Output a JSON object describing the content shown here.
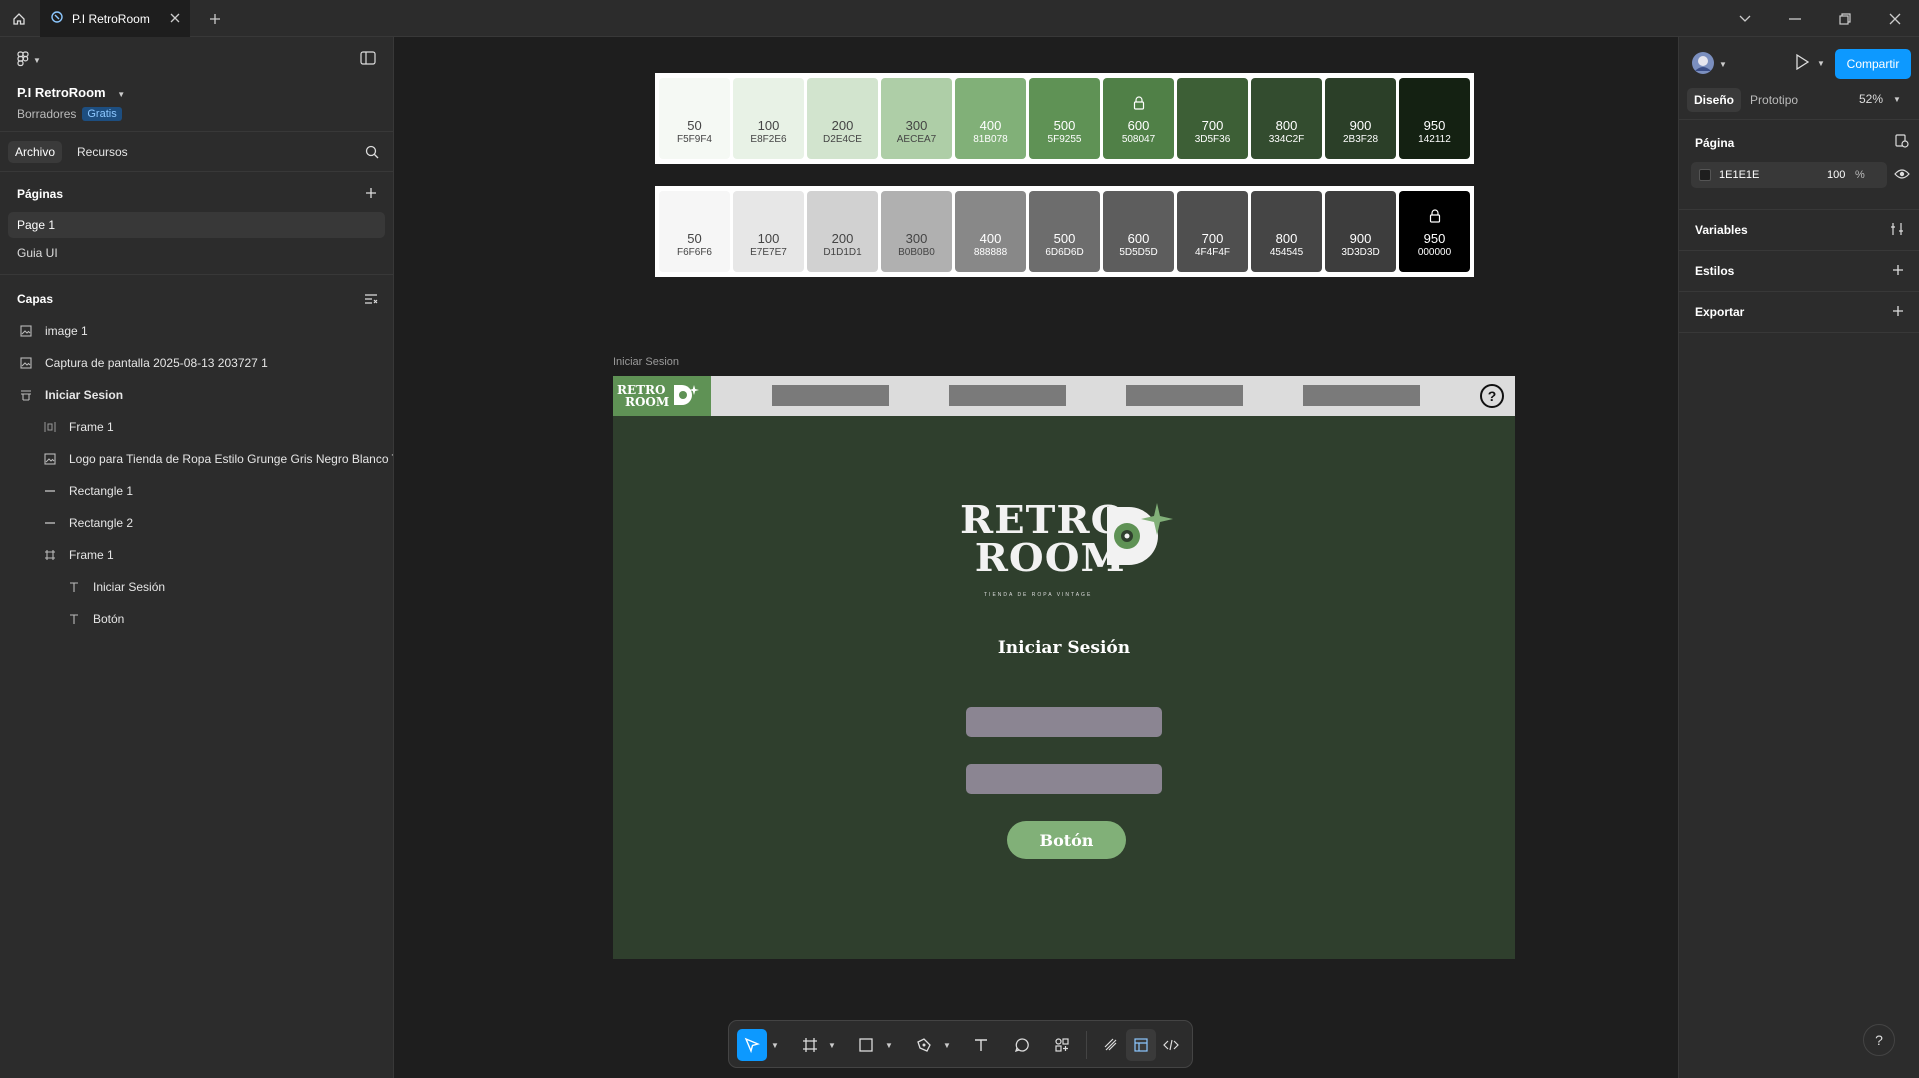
{
  "topbar": {
    "tab_title": "P.I RetroRoom"
  },
  "left_panel": {
    "file_name": "P.I RetroRoom",
    "team": "Borradores",
    "plan_badge": "Gratis",
    "tabs": [
      "Archivo",
      "Recursos"
    ],
    "pages_header": "Páginas",
    "pages": [
      "Page 1",
      "Guia UI"
    ],
    "layers_header": "Capas",
    "layers": [
      {
        "label": "image 1",
        "icon": "image-icon",
        "indent": 0
      },
      {
        "label": "Captura de pantalla 2025-08-13 203727 1",
        "icon": "image-icon",
        "indent": 0
      },
      {
        "label": "Iniciar Sesion",
        "icon": "frame-layout-icon",
        "indent": 0
      },
      {
        "label": "Frame 1",
        "icon": "autolayout-icon",
        "indent": 1
      },
      {
        "label": "Logo para Tienda de Ropa Estilo Grunge Gris Negro Blanco Tur",
        "icon": "image-icon",
        "indent": 1
      },
      {
        "label": "Rectangle 1",
        "icon": "line-icon",
        "indent": 1
      },
      {
        "label": "Rectangle 2",
        "icon": "line-icon",
        "indent": 1
      },
      {
        "label": "Frame 1",
        "icon": "frame-icon",
        "indent": 1
      },
      {
        "label": "Iniciar Sesión",
        "icon": "text-icon",
        "indent": 2
      },
      {
        "label": "Botón",
        "icon": "text-icon",
        "indent": 2
      }
    ]
  },
  "right_panel": {
    "share_label": "Compartir",
    "tabs": [
      "Diseño",
      "Prototipo"
    ],
    "zoom": "52%",
    "page_header": "Página",
    "page_color": "1E1E1E",
    "page_opacity": "100",
    "percent_sign": "%",
    "variables": "Variables",
    "styles": "Estilos",
    "export": "Exportar"
  },
  "canvas": {
    "green_palette": [
      {
        "name": "50",
        "hex": "F5F9F4",
        "color": "#F5F9F4",
        "text": "#444444",
        "locked": false
      },
      {
        "name": "100",
        "hex": "E8F2E6",
        "color": "#E8F2E6",
        "text": "#444444",
        "locked": false
      },
      {
        "name": "200",
        "hex": "D2E4CE",
        "color": "#D2E4CE",
        "text": "#444444",
        "locked": false
      },
      {
        "name": "300",
        "hex": "AECEA7",
        "color": "#AECEA7",
        "text": "#444444",
        "locked": false
      },
      {
        "name": "400",
        "hex": "81B078",
        "color": "#81B078",
        "text": "#ffffff",
        "locked": false
      },
      {
        "name": "500",
        "hex": "5F9255",
        "color": "#5F9255",
        "text": "#ffffff",
        "locked": false
      },
      {
        "name": "600",
        "hex": "508047",
        "color": "#508047",
        "text": "#ffffff",
        "locked": true
      },
      {
        "name": "700",
        "hex": "3D5F36",
        "color": "#3D5F36",
        "text": "#ffffff",
        "locked": false
      },
      {
        "name": "800",
        "hex": "334C2F",
        "color": "#334C2F",
        "text": "#ffffff",
        "locked": false
      },
      {
        "name": "900",
        "hex": "2B3F28",
        "color": "#2B3F28",
        "text": "#ffffff",
        "locked": false
      },
      {
        "name": "950",
        "hex": "142112",
        "color": "#142112",
        "text": "#ffffff",
        "locked": false
      }
    ],
    "gray_palette": [
      {
        "name": "50",
        "hex": "F6F6F6",
        "color": "#F6F6F6",
        "text": "#444444",
        "locked": false
      },
      {
        "name": "100",
        "hex": "E7E7E7",
        "color": "#E7E7E7",
        "text": "#444444",
        "locked": false
      },
      {
        "name": "200",
        "hex": "D1D1D1",
        "color": "#D1D1D1",
        "text": "#444444",
        "locked": false
      },
      {
        "name": "300",
        "hex": "B0B0B0",
        "color": "#B0B0B0",
        "text": "#444444",
        "locked": false
      },
      {
        "name": "400",
        "hex": "888888",
        "color": "#888888",
        "text": "#ffffff",
        "locked": false
      },
      {
        "name": "500",
        "hex": "6D6D6D",
        "color": "#6D6D6D",
        "text": "#ffffff",
        "locked": false
      },
      {
        "name": "600",
        "hex": "5D5D5D",
        "color": "#5D5D5D",
        "text": "#ffffff",
        "locked": false
      },
      {
        "name": "700",
        "hex": "4F4F4F",
        "color": "#4F4F4F",
        "text": "#ffffff",
        "locked": false
      },
      {
        "name": "800",
        "hex": "454545",
        "color": "#454545",
        "text": "#ffffff",
        "locked": false
      },
      {
        "name": "900",
        "hex": "3D3D3D",
        "color": "#3D3D3D",
        "text": "#ffffff",
        "locked": false
      },
      {
        "name": "950",
        "hex": "000000",
        "color": "#000000",
        "text": "#ffffff",
        "locked": true
      }
    ],
    "frame": {
      "label": "Iniciar Sesion",
      "logo_small_line1": "RETRO",
      "logo_small_line2": "ROOM",
      "logo_line1": "RETRO",
      "logo_line2": "ROOM",
      "tagline": "TIENDA DE ROPA VINTAGE",
      "title": "Iniciar Sesión",
      "button_label": "Botón",
      "help_symbol": "?"
    }
  },
  "help_fab": "?"
}
